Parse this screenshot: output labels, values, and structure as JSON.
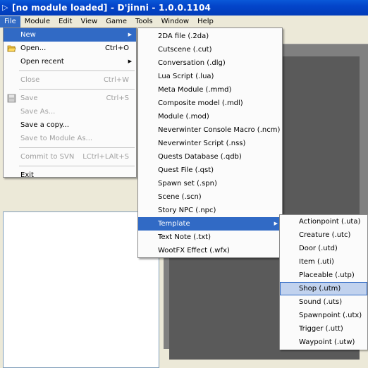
{
  "window": {
    "title": "[no module loaded] - D'jinni - 1.0.0.1104",
    "icon": "app-icon"
  },
  "menubar": {
    "items": [
      "File",
      "Module",
      "Edit",
      "View",
      "Game",
      "Tools",
      "Window",
      "Help"
    ],
    "active": "File"
  },
  "file_menu": {
    "new": "New",
    "open": "Open...",
    "open_shortcut": "Ctrl+O",
    "open_recent": "Open recent",
    "close": "Close",
    "close_shortcut": "Ctrl+W",
    "save": "Save",
    "save_shortcut": "Ctrl+S",
    "save_as": "Save As...",
    "save_copy": "Save a copy...",
    "save_to_module": "Save to Module As...",
    "commit_svn": "Commit to SVN",
    "commit_svn_shortcut": "LCtrl+LAlt+S",
    "exit": "Exit"
  },
  "new_menu": {
    "items": [
      "2DA file (.2da)",
      "Cutscene (.cut)",
      "Conversation (.dlg)",
      "Lua Script (.lua)",
      "Meta Module (.mmd)",
      "Composite model (.mdl)",
      "Module (.mod)",
      "Neverwinter Console Macro (.ncm)",
      "Neverwinter Script (.nss)",
      "Quests Database (.qdb)",
      "Quest File (.qst)",
      "Spawn set (.spn)",
      "Scene (.scn)",
      "Story NPC (.npc)",
      "Template",
      "Text Note (.txt)",
      "WootFX Effect (.wfx)"
    ]
  },
  "template_menu": {
    "items": [
      "Actionpoint (.uta)",
      "Creature (.utc)",
      "Door (.utd)",
      "Item (.uti)",
      "Placeable (.utp)",
      "Shop (.utm)",
      "Sound (.uts)",
      "Spawnpoint (.utx)",
      "Trigger (.utt)",
      "Waypoint (.utw)"
    ],
    "highlighted": "Shop (.utm)"
  },
  "colors": {
    "title_bar": "#0344c9",
    "menu_highlight": "#316ac5",
    "template_highlight": "#c1d2ee"
  }
}
